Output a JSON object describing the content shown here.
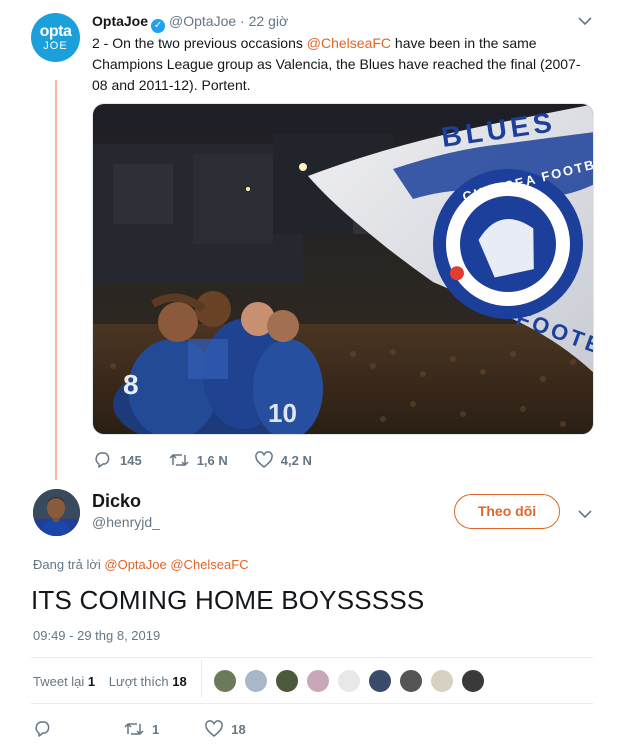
{
  "parent_tweet": {
    "avatar_text_top": "opta",
    "avatar_text_bottom": "JOE",
    "author_name": "OptaJoe",
    "author_handle": "@OptaJoe",
    "separator": " · ",
    "time": "22 giờ",
    "text_before": "2 - On the two previous occasions ",
    "mention": "@ChelseaFC",
    "text_after": " have been in the same Champions League group as Valencia, the Blues have reached the final (2007-08 and 2011-12). Portent.",
    "photo_flag_text": "BLUES",
    "photo_crest_text": "CHELSEA FOOTBALL CLUB",
    "photo_flag_side_text": "FOOTB",
    "replies": "145",
    "retweets": "1,6 N",
    "likes": "4,2 N"
  },
  "reply_tweet": {
    "author_name": "Dicko",
    "author_handle": "@henryjd_",
    "follow_label": "Theo dõi",
    "replying_to_label": "Đang trả lời ",
    "replying_to_1": "@OptaJoe",
    "replying_to_2": "@ChelseaFC",
    "text": "ITS COMING HOME BOYSSSSS",
    "timestamp": "09:49 - 29 thg 8, 2019",
    "retweets_label": "Tweet lại ",
    "retweets_count": "1",
    "likes_label": "Lượt thích ",
    "likes_count": "18",
    "reply_retweets": "1",
    "reply_likes": "18"
  },
  "likers": [
    {
      "name": "liker-1",
      "color": "#6b7a5a"
    },
    {
      "name": "liker-2",
      "color": "#a8b8c8"
    },
    {
      "name": "liker-3",
      "color": "#4a5a3a"
    },
    {
      "name": "liker-4",
      "color": "#c8a8b8"
    },
    {
      "name": "liker-5",
      "color": "#e8e8e8"
    },
    {
      "name": "liker-6",
      "color": "#3a4a6a"
    },
    {
      "name": "liker-7",
      "color": "#555555"
    },
    {
      "name": "liker-8",
      "color": "#d8d0c0"
    },
    {
      "name": "liker-9",
      "color": "#3a3a3a"
    }
  ],
  "colors": {
    "accent": "#e0662b",
    "secondary_text": "#657786",
    "thread_line": "#f6b7a4",
    "opta_blue": "#1ca0dc",
    "verified": "#1da1f2"
  }
}
